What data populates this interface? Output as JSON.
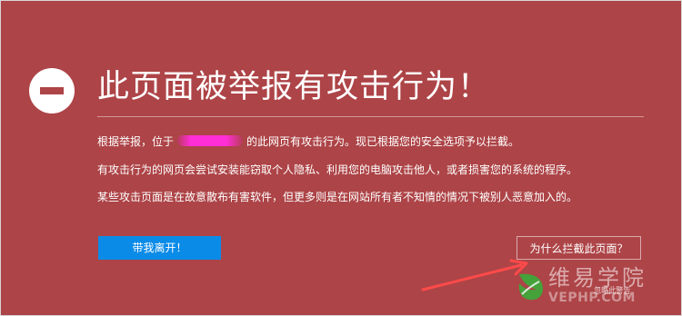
{
  "warning": {
    "icon": "block-icon",
    "title": "此页面被举报有攻击行为！",
    "line1_before": "根据举报，位于",
    "line1_after": "的此网页有攻击行为。现已根据您的安全选项予以拦截。",
    "line2": "有攻击行为的网页会尝试安装能窃取个人隐私、利用您的电脑攻击他人，或者损害您的系统的程序。",
    "line3": "某些攻击页面是在故意散布有害软件，但更多则是在网站所有者不知情的情况下被别人恶意加入的。"
  },
  "actions": {
    "leave_label": "带我离开！",
    "why_label": "为什么拦截此页面？",
    "ignore_label": "忽略此警告"
  },
  "watermark": {
    "title": "维易学院",
    "url": "VEPHP.COM"
  },
  "colors": {
    "background": "#ad4447",
    "primary_button": "#0b8be8",
    "text": "#ffffff",
    "annotation_mark": "#ff2ed6",
    "annotation_arrow": "#ff4a4a",
    "watermark_leaf": "#45a13a"
  }
}
